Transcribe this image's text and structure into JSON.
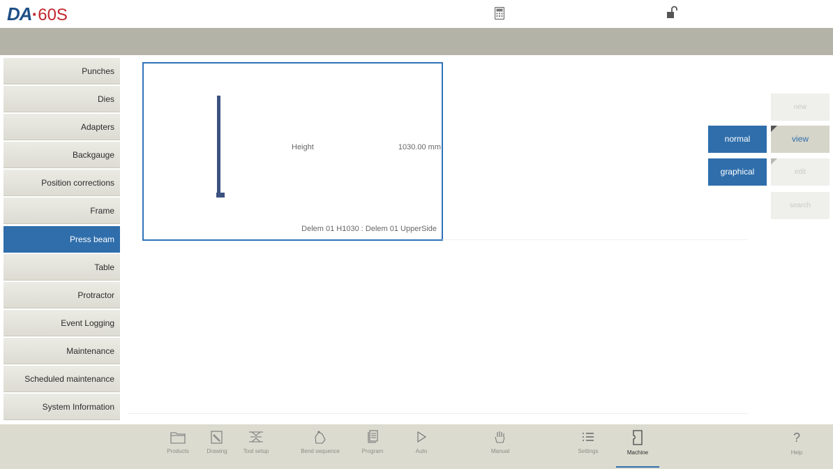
{
  "app": {
    "brand": "DA",
    "separator": "·",
    "model": "60S"
  },
  "topbar": {
    "calculator_icon": "calculator-icon",
    "lock_icon": "unlocked-padlock-icon"
  },
  "sidebar": {
    "items": [
      {
        "label": "Punches",
        "active": false
      },
      {
        "label": "Dies",
        "active": false
      },
      {
        "label": "Adapters",
        "active": false
      },
      {
        "label": "Backgauge",
        "active": false
      },
      {
        "label": "Position corrections",
        "active": false
      },
      {
        "label": "Frame",
        "active": false
      },
      {
        "label": "Press beam",
        "active": true
      },
      {
        "label": "Table",
        "active": false
      },
      {
        "label": "Protractor",
        "active": false
      },
      {
        "label": "Event Logging",
        "active": false
      },
      {
        "label": "Maintenance",
        "active": false
      },
      {
        "label": "Scheduled maintenance",
        "active": false
      },
      {
        "label": "System Information",
        "active": false
      }
    ]
  },
  "panel": {
    "height_label": "Height",
    "height_value": "1030.00 mm",
    "caption": "Delem 01 H1030 : Delem 01 UpperSide"
  },
  "buttons": {
    "new": "new",
    "normal": "normal",
    "view": "view",
    "graphical": "graphical",
    "edit": "edit",
    "search": "search"
  },
  "toolbar": {
    "items": [
      {
        "label": "Products",
        "icon": "folder-icon"
      },
      {
        "label": "Drawing",
        "icon": "pencil-icon"
      },
      {
        "label": "Tool setup",
        "icon": "tool-setup-icon"
      },
      {
        "label": "Bend sequence",
        "icon": "bend-sequence-icon"
      },
      {
        "label": "Program",
        "icon": "program-pages-icon"
      },
      {
        "label": "Auto",
        "icon": "play-icon"
      },
      {
        "label": "Manual",
        "icon": "hand-icon"
      },
      {
        "label": "Settings",
        "icon": "list-icon"
      },
      {
        "label": "Machine",
        "icon": "machine-icon"
      },
      {
        "label": "Help",
        "icon": "help-icon"
      }
    ],
    "active": "Machine"
  },
  "colors": {
    "accent_blue": "#2f6eab",
    "grey_bar": "#b4b3a7",
    "bottom_bar": "#dcdbd0",
    "beam": "#3c5280",
    "brand_red": "#c1272d"
  }
}
